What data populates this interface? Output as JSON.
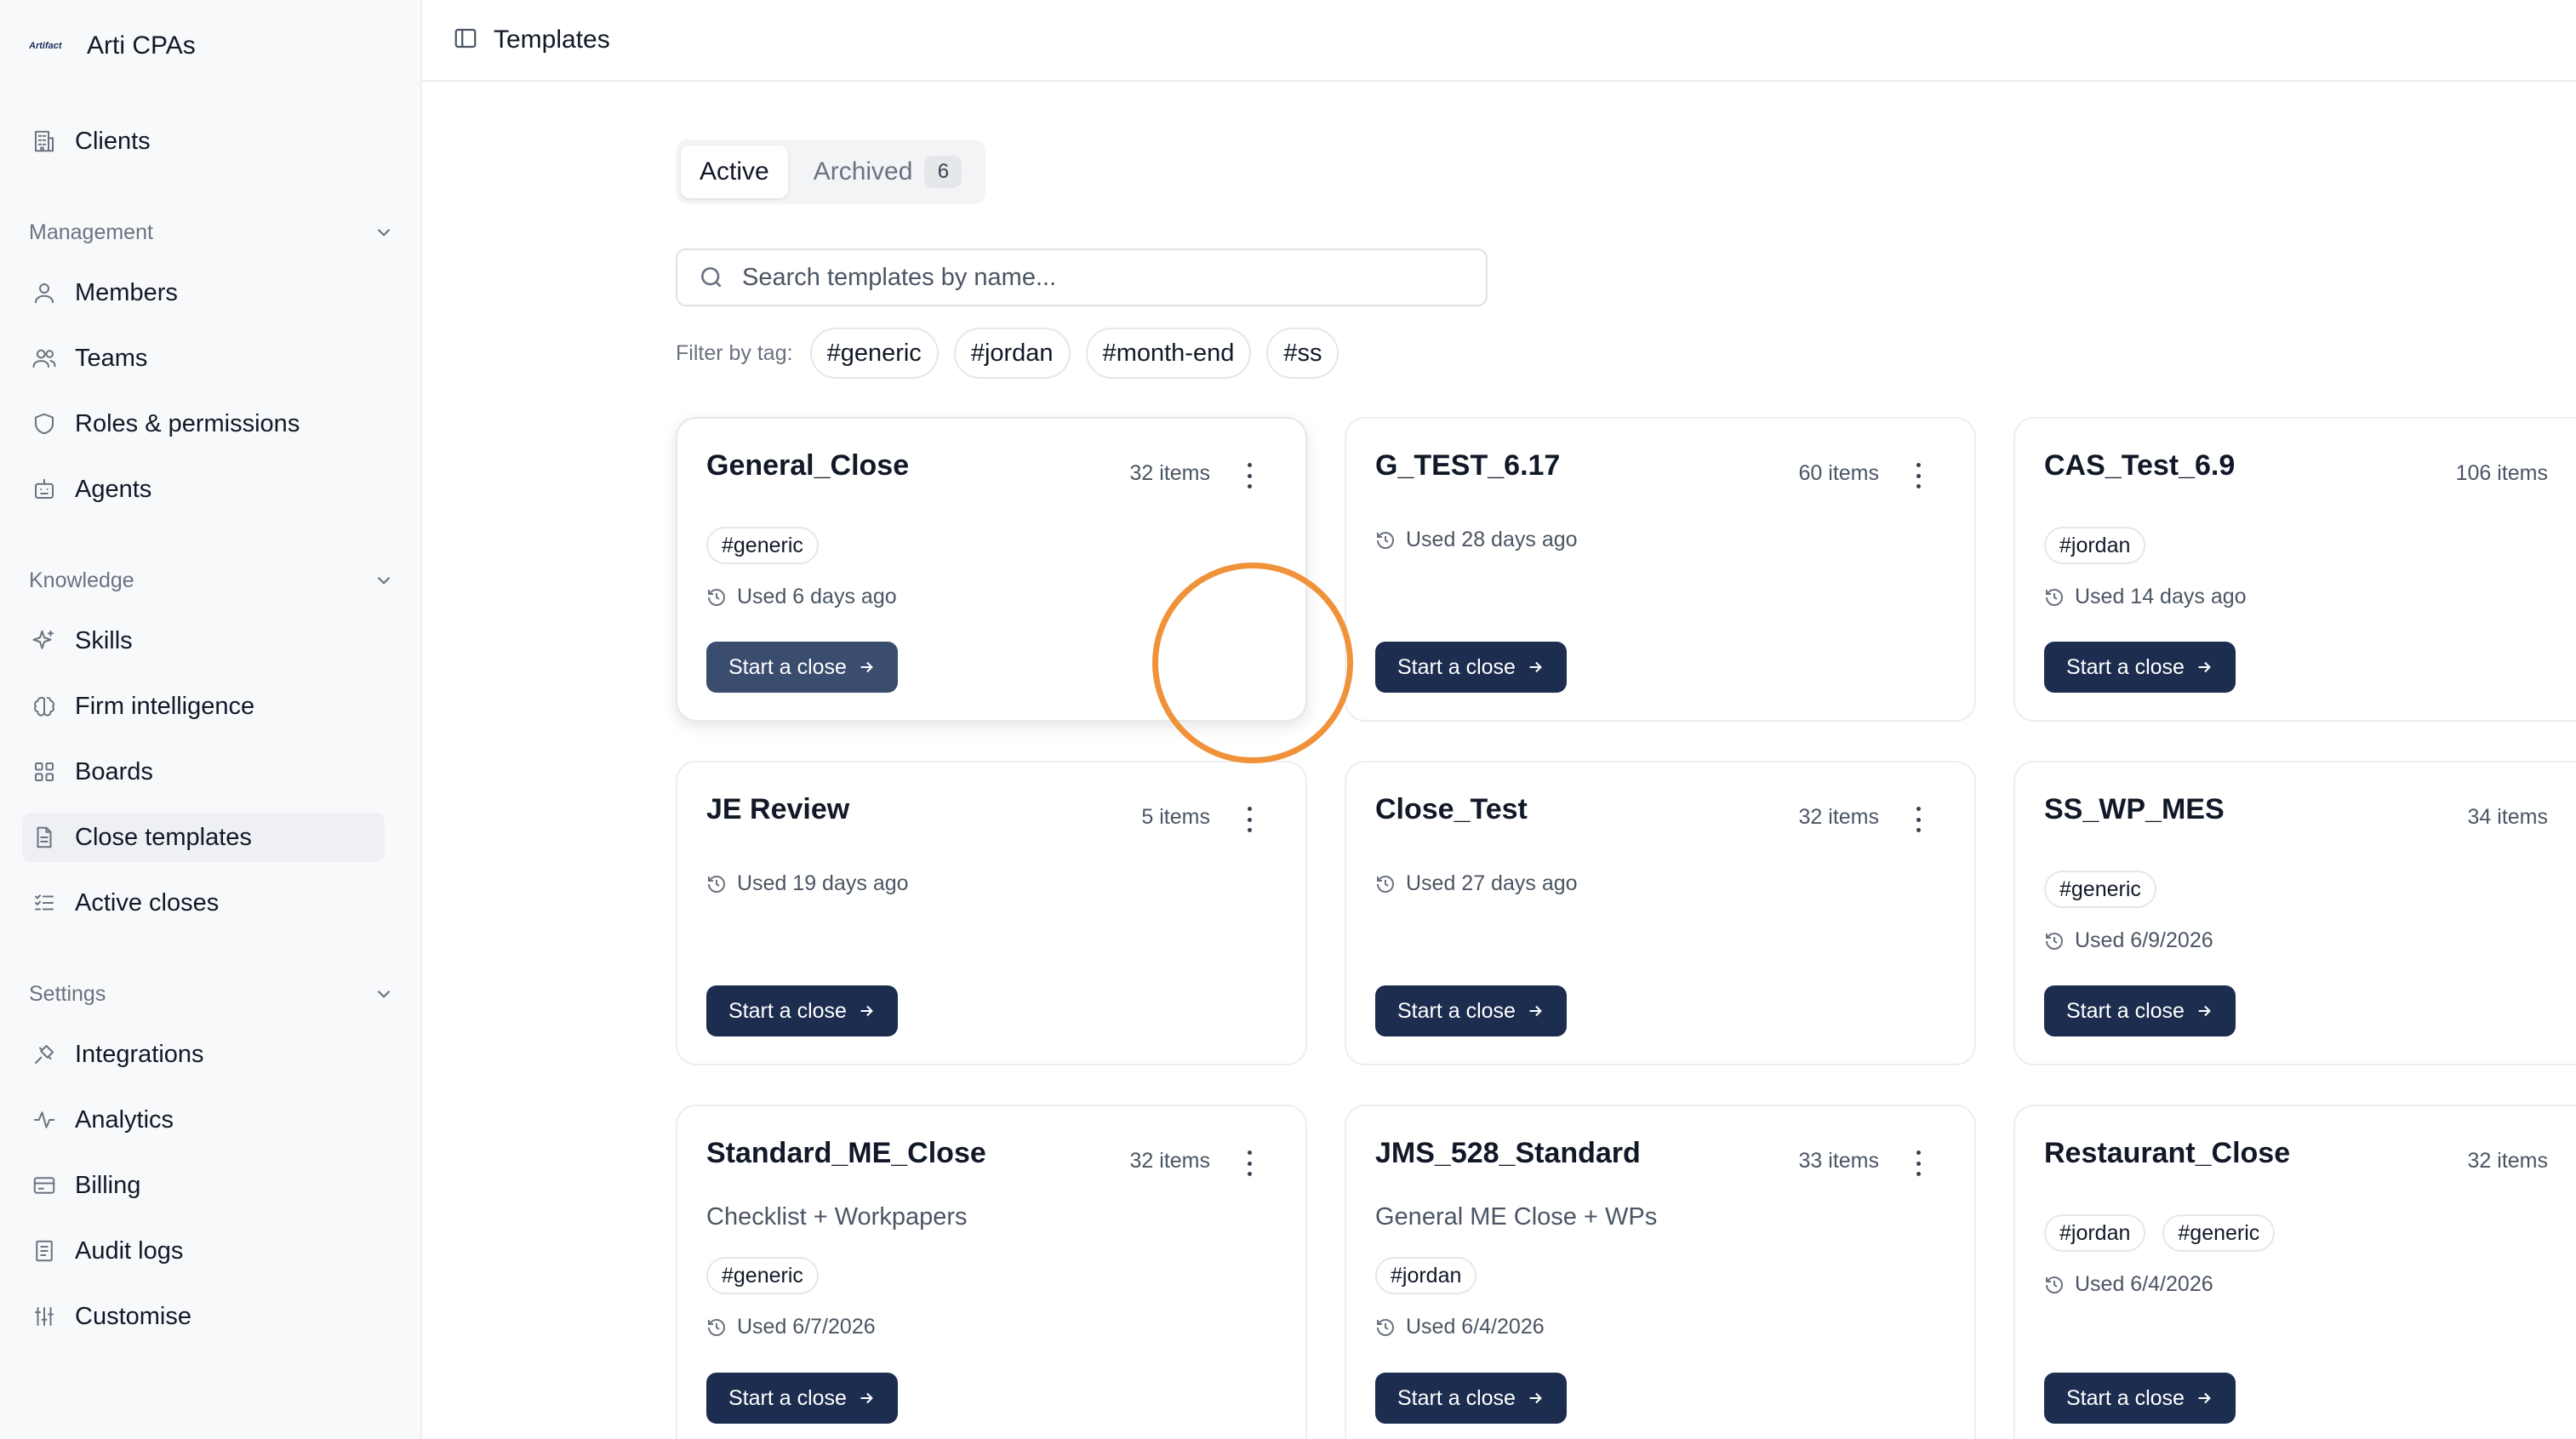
{
  "brand": {
    "logo_text": "Artifact",
    "name": "Arti CPAs"
  },
  "sidebar": {
    "clients": "Clients",
    "management": {
      "label": "Management",
      "items": [
        "Members",
        "Teams",
        "Roles & permissions",
        "Agents"
      ]
    },
    "knowledge": {
      "label": "Knowledge",
      "items": [
        "Skills",
        "Firm intelligence",
        "Boards",
        "Close templates",
        "Active closes"
      ]
    },
    "settings": {
      "label": "Settings",
      "items": [
        "Integrations",
        "Analytics",
        "Billing",
        "Audit logs",
        "Customise"
      ]
    }
  },
  "topbar": {
    "title": "Templates"
  },
  "tabs": {
    "active": "Active",
    "archived": "Archived",
    "archived_count": "6"
  },
  "search": {
    "placeholder": "Search templates by name..."
  },
  "filter": {
    "label": "Filter by tag:",
    "tags": [
      "#generic",
      "#jordan",
      "#month-end",
      "#ss"
    ]
  },
  "cards": [
    {
      "title": "General_Close",
      "count": "32 items",
      "tags": [
        "#generic"
      ],
      "used": "Used 6 days ago",
      "button": "Start a close"
    },
    {
      "title": "G_TEST_6.17",
      "count": "60 items",
      "used": "Used 28 days ago",
      "button": "Start a close"
    },
    {
      "title": "CAS_Test_6.9",
      "count": "106 items",
      "tags": [
        "#jordan"
      ],
      "used": "Used 14 days ago",
      "button": "Start a close"
    },
    {
      "title": "JE Review",
      "count": "5 items",
      "used": "Used 19 days ago",
      "button": "Start a close"
    },
    {
      "title": "Close_Test",
      "count": "32 items",
      "used": "Used 27 days ago",
      "button": "Start a close"
    },
    {
      "title": "SS_WP_MES",
      "count": "34 items",
      "tags": [
        "#generic"
      ],
      "used": "Used 6/9/2026",
      "button": "Start a close"
    },
    {
      "title": "Standard_ME_Close",
      "count": "32 items",
      "description": "Checklist + Workpapers",
      "tags": [
        "#generic"
      ],
      "used": "Used 6/7/2026",
      "button": "Start a close"
    },
    {
      "title": "JMS_528_Standard",
      "count": "33 items",
      "description": "General ME Close + WPs",
      "tags": [
        "#jordan"
      ],
      "used": "Used 6/4/2026",
      "button": "Start a close"
    },
    {
      "title": "Restaurant_Close",
      "count": "32 items",
      "tags": [
        "#jordan",
        "#generic"
      ],
      "used": "Used 6/4/2026",
      "button": "Start a close"
    }
  ]
}
